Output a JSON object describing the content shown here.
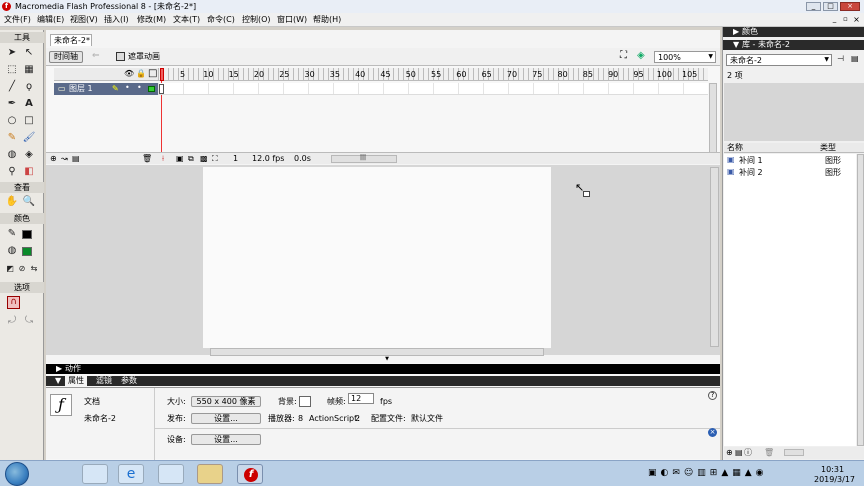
{
  "window": {
    "title": "Macromedia Flash Professional 8 - [未命名-2*]"
  },
  "menu": [
    "文件(F)",
    "编辑(E)",
    "视图(V)",
    "插入(I)",
    "修改(M)",
    "文本(T)",
    "命令(C)",
    "控制(O)",
    "窗口(W)",
    "帮助(H)"
  ],
  "toolbox": {
    "title": "工具",
    "view": "查看",
    "colors": "颜色",
    "options": "选项"
  },
  "document": {
    "tab": "未命名-2*",
    "timeline_button": "时间轴",
    "scene": "遮罩动画",
    "zoom": "100%"
  },
  "timeline": {
    "ruler": [
      "5",
      "10",
      "15",
      "20",
      "25",
      "30",
      "35",
      "40",
      "45",
      "50",
      "55",
      "60",
      "65",
      "70",
      "75",
      "80",
      "85",
      "90",
      "95",
      "100",
      "105"
    ],
    "layer": "图层 1",
    "current_frame": "1",
    "fps": "12.0 fps",
    "time": "0.0s"
  },
  "panels": {
    "actions": "动作",
    "tabs": [
      "属性",
      "滤镜",
      "参数"
    ]
  },
  "properties": {
    "doc_label": "文档",
    "doc_name": "未命名-2",
    "size_label": "大小:",
    "size_value": "550 x 400 像素",
    "bg_label": "背景:",
    "rate_label": "帧频:",
    "rate_value": "12",
    "fps_unit": "fps",
    "publish_label": "发布:",
    "settings_btn": "设置...",
    "player_label": "播放器:",
    "player_value": "8",
    "as_label": "ActionScript:",
    "as_value": "2",
    "profile_label": "配置文件:",
    "profile_value": "默认文件",
    "device_label": "设备:",
    "device_btn": "设置..."
  },
  "right": {
    "color_panel": "颜色",
    "library_panel": "库 - 未命名-2",
    "library_select": "未命名-2",
    "item_count": "2 项",
    "col_name": "名称",
    "col_type": "类型",
    "items": [
      {
        "name": "补间 1",
        "type": "图形"
      },
      {
        "name": "补间 2",
        "type": "图形"
      }
    ]
  },
  "taskbar": {
    "time": "10:31",
    "date": "2019/3/17"
  }
}
